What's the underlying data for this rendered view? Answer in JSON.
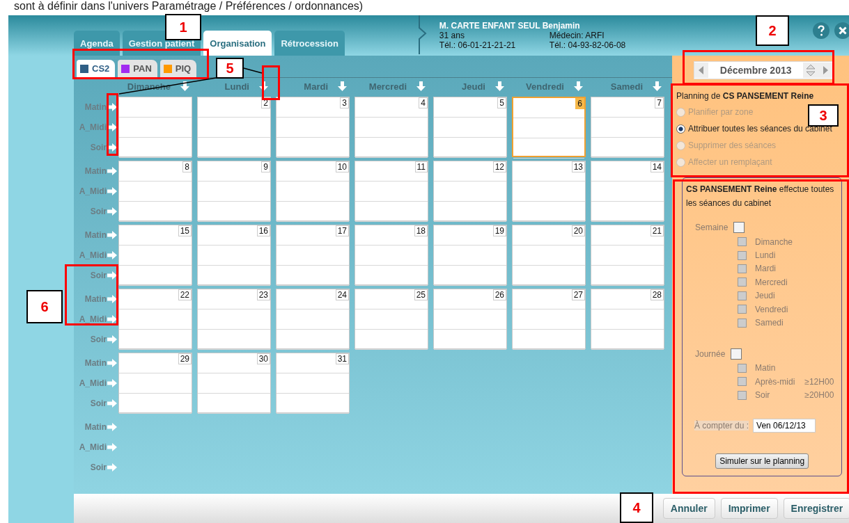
{
  "caption": "sont à définir dans l'univers Paramétrage / Préférences / ordonnances)",
  "header": {
    "patient_name": "M. CARTE ENFANT SEUL Benjamin",
    "age": "31 ans",
    "phone": "Tél.: 06-01-21-21-21",
    "doctor": "Médecin: ARFI",
    "doctor_phone": "Tél.: 04-93-82-06-08"
  },
  "tabs": [
    {
      "label": "Agenda",
      "selected": false
    },
    {
      "label": "Gestion patient",
      "selected": false
    },
    {
      "label": "Organisation",
      "selected": true
    },
    {
      "label": "Rétrocession",
      "selected": false
    }
  ],
  "sub_tabs": [
    {
      "label": "CS2",
      "color": "#2f5f86",
      "selected": true
    },
    {
      "label": "PAN",
      "color": "#a22cf0",
      "selected": false
    },
    {
      "label": "PIQ",
      "color": "#ff9900",
      "selected": false
    }
  ],
  "weekdays": [
    "Dimanche",
    "Lundi",
    "Mardi",
    "Mercredi",
    "Jeudi",
    "Vendredi",
    "Samedi"
  ],
  "weeks": [
    {
      "slots": [
        "Matin",
        "A_Midi",
        "Soir"
      ],
      "days": [
        {
          "highlighted": false
        },
        {
          "number": "2",
          "highlighted": false
        },
        {
          "number": "3",
          "highlighted": false
        },
        {
          "number": "4",
          "highlighted": false
        },
        {
          "number": "5",
          "highlighted": false
        },
        {
          "number": "6",
          "highlighted": true
        },
        {
          "number": "7",
          "highlighted": false
        }
      ]
    },
    {
      "slots": [
        "Matin",
        "A_Midi",
        "Soir"
      ],
      "days": [
        {
          "number": "8",
          "highlighted": false
        },
        {
          "number": "9",
          "highlighted": false
        },
        {
          "number": "10",
          "highlighted": false
        },
        {
          "number": "11",
          "highlighted": false
        },
        {
          "number": "12",
          "highlighted": false
        },
        {
          "number": "13",
          "highlighted": false
        },
        {
          "number": "14",
          "highlighted": false
        }
      ]
    },
    {
      "slots": [
        "Matin",
        "A_Midi",
        "Soir"
      ],
      "days": [
        {
          "number": "15",
          "highlighted": false
        },
        {
          "number": "16",
          "highlighted": false
        },
        {
          "number": "17",
          "highlighted": false
        },
        {
          "number": "18",
          "highlighted": false
        },
        {
          "number": "19",
          "highlighted": false
        },
        {
          "number": "20",
          "highlighted": false
        },
        {
          "number": "21",
          "highlighted": false
        }
      ]
    },
    {
      "slots": [
        "Matin",
        "A_Midi",
        "Soir"
      ],
      "days": [
        {
          "number": "22",
          "highlighted": false
        },
        {
          "number": "23",
          "highlighted": false
        },
        {
          "number": "24",
          "highlighted": false
        },
        {
          "number": "25",
          "highlighted": false
        },
        {
          "number": "26",
          "highlighted": false
        },
        {
          "number": "27",
          "highlighted": false
        },
        {
          "number": "28",
          "highlighted": false
        }
      ]
    },
    {
      "slots": [
        "Matin",
        "A_Midi",
        "Soir"
      ],
      "days": [
        {
          "number": "29",
          "highlighted": false
        },
        {
          "number": "30",
          "highlighted": false
        },
        {
          "number": "31",
          "highlighted": false
        }
      ]
    },
    {
      "slots": [
        "Matin",
        "A_Midi",
        "Soir"
      ]
    }
  ],
  "month_nav": {
    "value": "Décembre 2013"
  },
  "planning": {
    "title": "Planning de **CS PANSEMENT Reine**",
    "options": [
      {
        "label": "Planifier par zone",
        "selected": false,
        "disabled": true
      },
      {
        "label": "Attribuer toutes les séances du cabinet",
        "selected": true,
        "disabled": false
      },
      {
        "label": "Supprimer des séances",
        "selected": false,
        "disabled": true
      },
      {
        "label": "Affecter un remplaçant",
        "selected": false,
        "disabled": true
      }
    ]
  },
  "detail": {
    "summary": "**CS PANSEMENT Reine** effectue toutes les séances du cabinet",
    "groups": [
      {
        "label": "Semaine",
        "checked": false,
        "items": [
          {
            "label": "Dimanche",
            "checked": false,
            "disabled": true
          },
          {
            "label": "Lundi",
            "checked": false,
            "disabled": true
          },
          {
            "label": "Mardi",
            "checked": false,
            "disabled": true
          },
          {
            "label": "Mercredi",
            "checked": false,
            "disabled": true
          },
          {
            "label": "Jeudi",
            "checked": false,
            "disabled": true
          },
          {
            "label": "Vendredi",
            "checked": false,
            "disabled": true
          },
          {
            "label": "Samedi",
            "checked": false,
            "disabled": true
          }
        ]
      },
      {
        "label": "Journée",
        "checked": false,
        "items": [
          {
            "label": "Matin",
            "checked": false,
            "disabled": true
          },
          {
            "label": "Après-midi",
            "note": "≥12H00",
            "checked": false,
            "disabled": true
          },
          {
            "label": "Soir",
            "note": "≥20H00",
            "checked": false,
            "disabled": true
          }
        ]
      }
    ],
    "start_label": "À compter du :",
    "start_value": "Ven 06/12/13",
    "simulate_button": "Simuler sur le planning"
  },
  "footer_buttons": [
    "Annuler",
    "Imprimer",
    "Enregistrer"
  ],
  "callouts": [
    "1",
    "2",
    "3",
    "4",
    "5",
    "6"
  ]
}
